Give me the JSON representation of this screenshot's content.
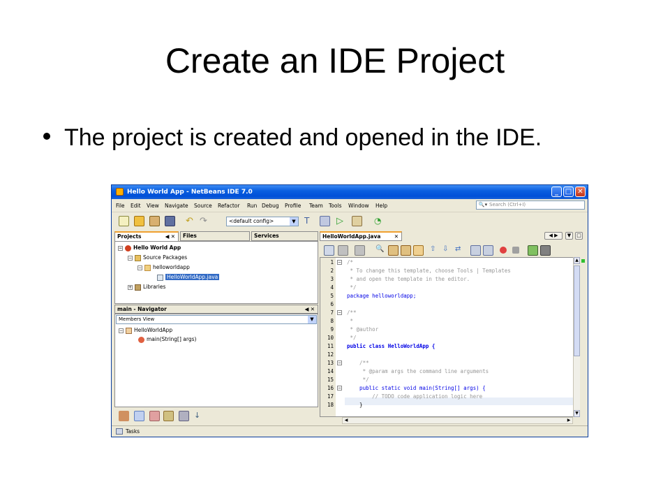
{
  "slide": {
    "title": "Create an IDE Project",
    "bullet": "The project is created and opened in the IDE."
  },
  "window": {
    "title": "Hello World App - NetBeans IDE 7.0",
    "controls": [
      "minimize-icon",
      "maximize-icon",
      "close-icon"
    ]
  },
  "menu": [
    "File",
    "Edit",
    "View",
    "Navigate",
    "Source",
    "Refactor",
    "Run",
    "Debug",
    "Profile",
    "Team",
    "Tools",
    "Window",
    "Help"
  ],
  "search": {
    "placeholder": "Search (Ctrl+I)"
  },
  "toolbar": {
    "config": "<default config>"
  },
  "projects_panel": {
    "tabs": [
      "Projects",
      "Files",
      "Services"
    ],
    "tree": {
      "project": "Hello World App",
      "source_packages": "Source Packages",
      "package": "helloworldapp",
      "file": "HelloWorldApp.java",
      "libraries": "Libraries"
    }
  },
  "navigator": {
    "title": "main - Navigator",
    "view": "Members View",
    "class": "HelloWorldApp",
    "member": "main(String[] args)"
  },
  "editor": {
    "tab": "HelloWorldApp.java",
    "lines": [
      "/*",
      " * To change this template, choose Tools | Templates",
      " * and open the template in the editor.",
      " */",
      "package helloworldapp;",
      "",
      "/**",
      " *",
      " * @author",
      " */",
      "public class HelloWorldApp {",
      "",
      "    /**",
      "     * @param args the command line arguments",
      "     */",
      "    public static void main(String[] args) {",
      "        // TODO code application logic here",
      "    }"
    ],
    "line_numbers": [
      "1",
      "2",
      "3",
      "4",
      "5",
      "6",
      "7",
      "8",
      "9",
      "10",
      "11",
      "12",
      "13",
      "14",
      "15",
      "16",
      "17",
      "18"
    ]
  },
  "status": {
    "tasks": "Tasks"
  },
  "colors": {
    "titlebar": "#0050d8",
    "selection": "#316ac5",
    "keyword": "#0000e6",
    "comment": "#969696"
  }
}
